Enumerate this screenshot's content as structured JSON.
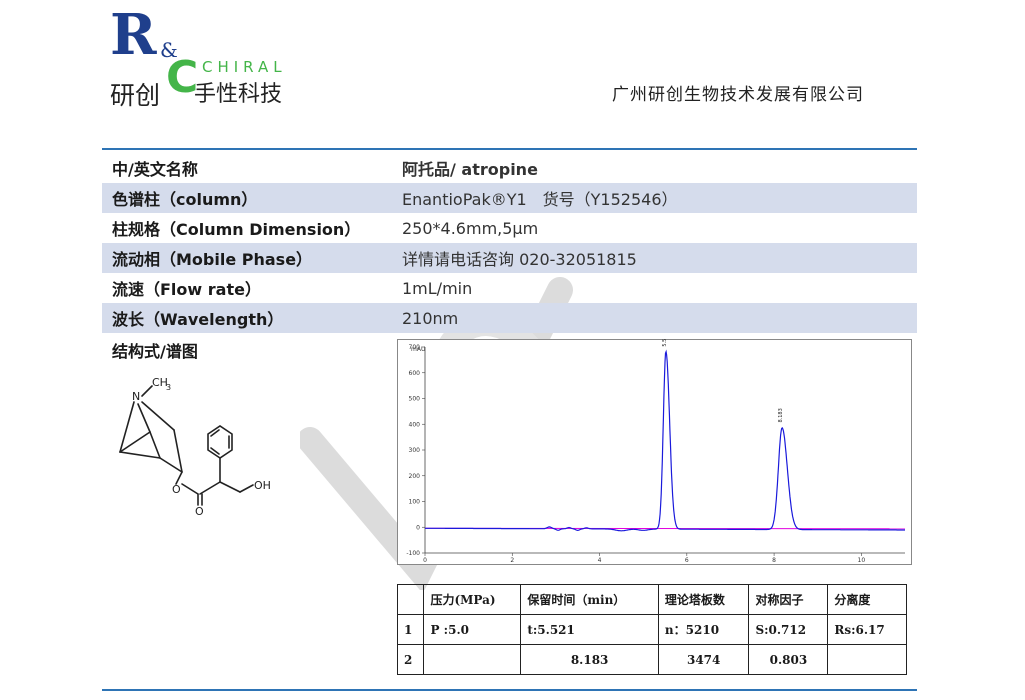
{
  "header": {
    "logo": {
      "r": "R",
      "amp": "&",
      "c": "C",
      "chiral": "CHIRAL",
      "cn_left": "研创",
      "cn_right": "手性科技"
    },
    "company": "广州研创生物技术发展有限公司"
  },
  "spec": [
    {
      "key": "中/英文名称",
      "value": "阿托品/ atropine",
      "shaded": false,
      "bold_value": true
    },
    {
      "key": "色谱柱（column）",
      "value": "EnantioPak®Y1　货号（Y152546）",
      "shaded": true,
      "bold_value": false
    },
    {
      "key": "柱规格（Column Dimension）",
      "value": "250*4.6mm,5µm",
      "shaded": false,
      "bold_value": false
    },
    {
      "key": "流动相（Mobile Phase）",
      "value": "详情请电话咨询 020-32051815",
      "shaded": true,
      "bold_value": false
    },
    {
      "key": "流速（Flow rate）",
      "value": "1mL/min",
      "shaded": false,
      "bold_value": false
    },
    {
      "key": "波长（Wavelength）",
      "value": "210nm",
      "shaded": true,
      "bold_value": false
    }
  ],
  "structure_label": "结构式/谱图",
  "molecule": {
    "methyl": "CH",
    "methyl_sub": "3",
    "n": "N",
    "o1": "O",
    "o2": "O",
    "oh": "OH"
  },
  "watermark": "YC",
  "chart_data": {
    "type": "line",
    "ylabel": "mAU",
    "xlim": [
      0,
      11
    ],
    "ylim": [
      -100,
      700
    ],
    "x_ticks": [
      0,
      2,
      4,
      6,
      8,
      10
    ],
    "y_ticks": [
      -100,
      0,
      100,
      200,
      300,
      400,
      500,
      600,
      700
    ],
    "peaks": [
      {
        "retention": 5.521,
        "height": 690,
        "label": "5.521"
      },
      {
        "retention": 8.183,
        "height": 395,
        "label": "8.183"
      }
    ],
    "colors": {
      "signal": "#1a1adb",
      "baseline": "#e000e0",
      "axis": "#444444"
    }
  },
  "results": {
    "headers": [
      "",
      "压力(MPa)",
      "保留时间（min）",
      "理论塔板数",
      "对称因子",
      "分离度"
    ],
    "rows": [
      [
        "1",
        "P :5.0",
        "t:5.521",
        "n：5210",
        "S:0.712",
        "Rs:6.17"
      ],
      [
        "2",
        "",
        "8.183",
        "3474",
        "0.803",
        ""
      ]
    ]
  }
}
